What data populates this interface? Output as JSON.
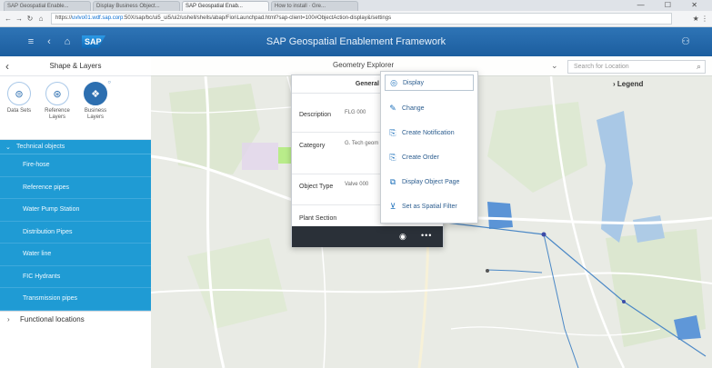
{
  "browser": {
    "tabs": [
      {
        "label": "SAP Geospatial Enable..."
      },
      {
        "label": "Display Business Object..."
      },
      {
        "label": "SAP Geospatial Enab..."
      },
      {
        "label": "How to install · Gre..."
      }
    ],
    "window_controls": "— ☐ ✕",
    "url_prefix": "https://",
    "url_host": "uvlvo01.wdf.sap.corp",
    "url_path": ":50X/sap/bc/ui5_ui5/ui2/ushell/shells/abap/FioriLaunchpad.html?sap-client=100#ObjectAction-display&/settings"
  },
  "shell": {
    "title": "SAP Geospatial Enablement Framework",
    "logo": "SAP"
  },
  "left_panel": {
    "title": "Shape & Layers",
    "tools": [
      {
        "icon": "layers-icon",
        "glyph": "⊜",
        "label": "Data Sets"
      },
      {
        "icon": "globe-icon",
        "glyph": "⊛",
        "label": "Reference Layers"
      },
      {
        "icon": "stack-icon",
        "glyph": "❖",
        "label": "Business Layers"
      }
    ],
    "group_expanded": "Technical objects",
    "items": [
      "Fire-hose",
      "Reference pipes",
      "Water Pump Station",
      "Distribution Pipes",
      "Water line",
      "FIC Hydrants",
      "Transmission pipes"
    ],
    "group_collapsed": "Functional locations"
  },
  "map": {
    "selector_label": "Geometry Explorer",
    "search_placeholder": "Search for Location",
    "legend_label": "Legend",
    "popup": {
      "header": "General",
      "rows": [
        {
          "label": "Description",
          "value": "FLG 000"
        },
        {
          "label": "Category",
          "value": "G. Tech geom"
        },
        {
          "label": "Object Type",
          "value": "Valve 000"
        },
        {
          "label": "Plant Section",
          "value": ""
        }
      ]
    },
    "menu": [
      {
        "icon": "display-icon",
        "glyph": "◎",
        "label": "Display"
      },
      {
        "icon": "change-icon",
        "glyph": "✎",
        "label": "Change"
      },
      {
        "icon": "notification-icon",
        "glyph": "⎘",
        "label": "Create Notification"
      },
      {
        "icon": "order-icon",
        "glyph": "⎘",
        "label": "Create Order"
      },
      {
        "icon": "object-page-icon",
        "glyph": "⧉",
        "label": "Display Object Page"
      },
      {
        "icon": "filter-icon",
        "glyph": "⊻",
        "label": "Set as Spatial Filter"
      }
    ]
  }
}
